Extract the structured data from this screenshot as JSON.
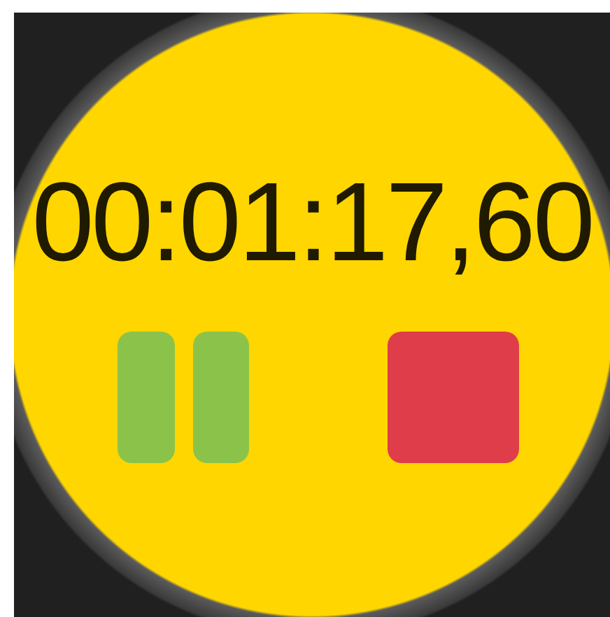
{
  "stopwatch": {
    "time": "00:01:17,60"
  },
  "controls": [
    {
      "kind": "pause"
    },
    {
      "kind": "stop"
    }
  ]
}
